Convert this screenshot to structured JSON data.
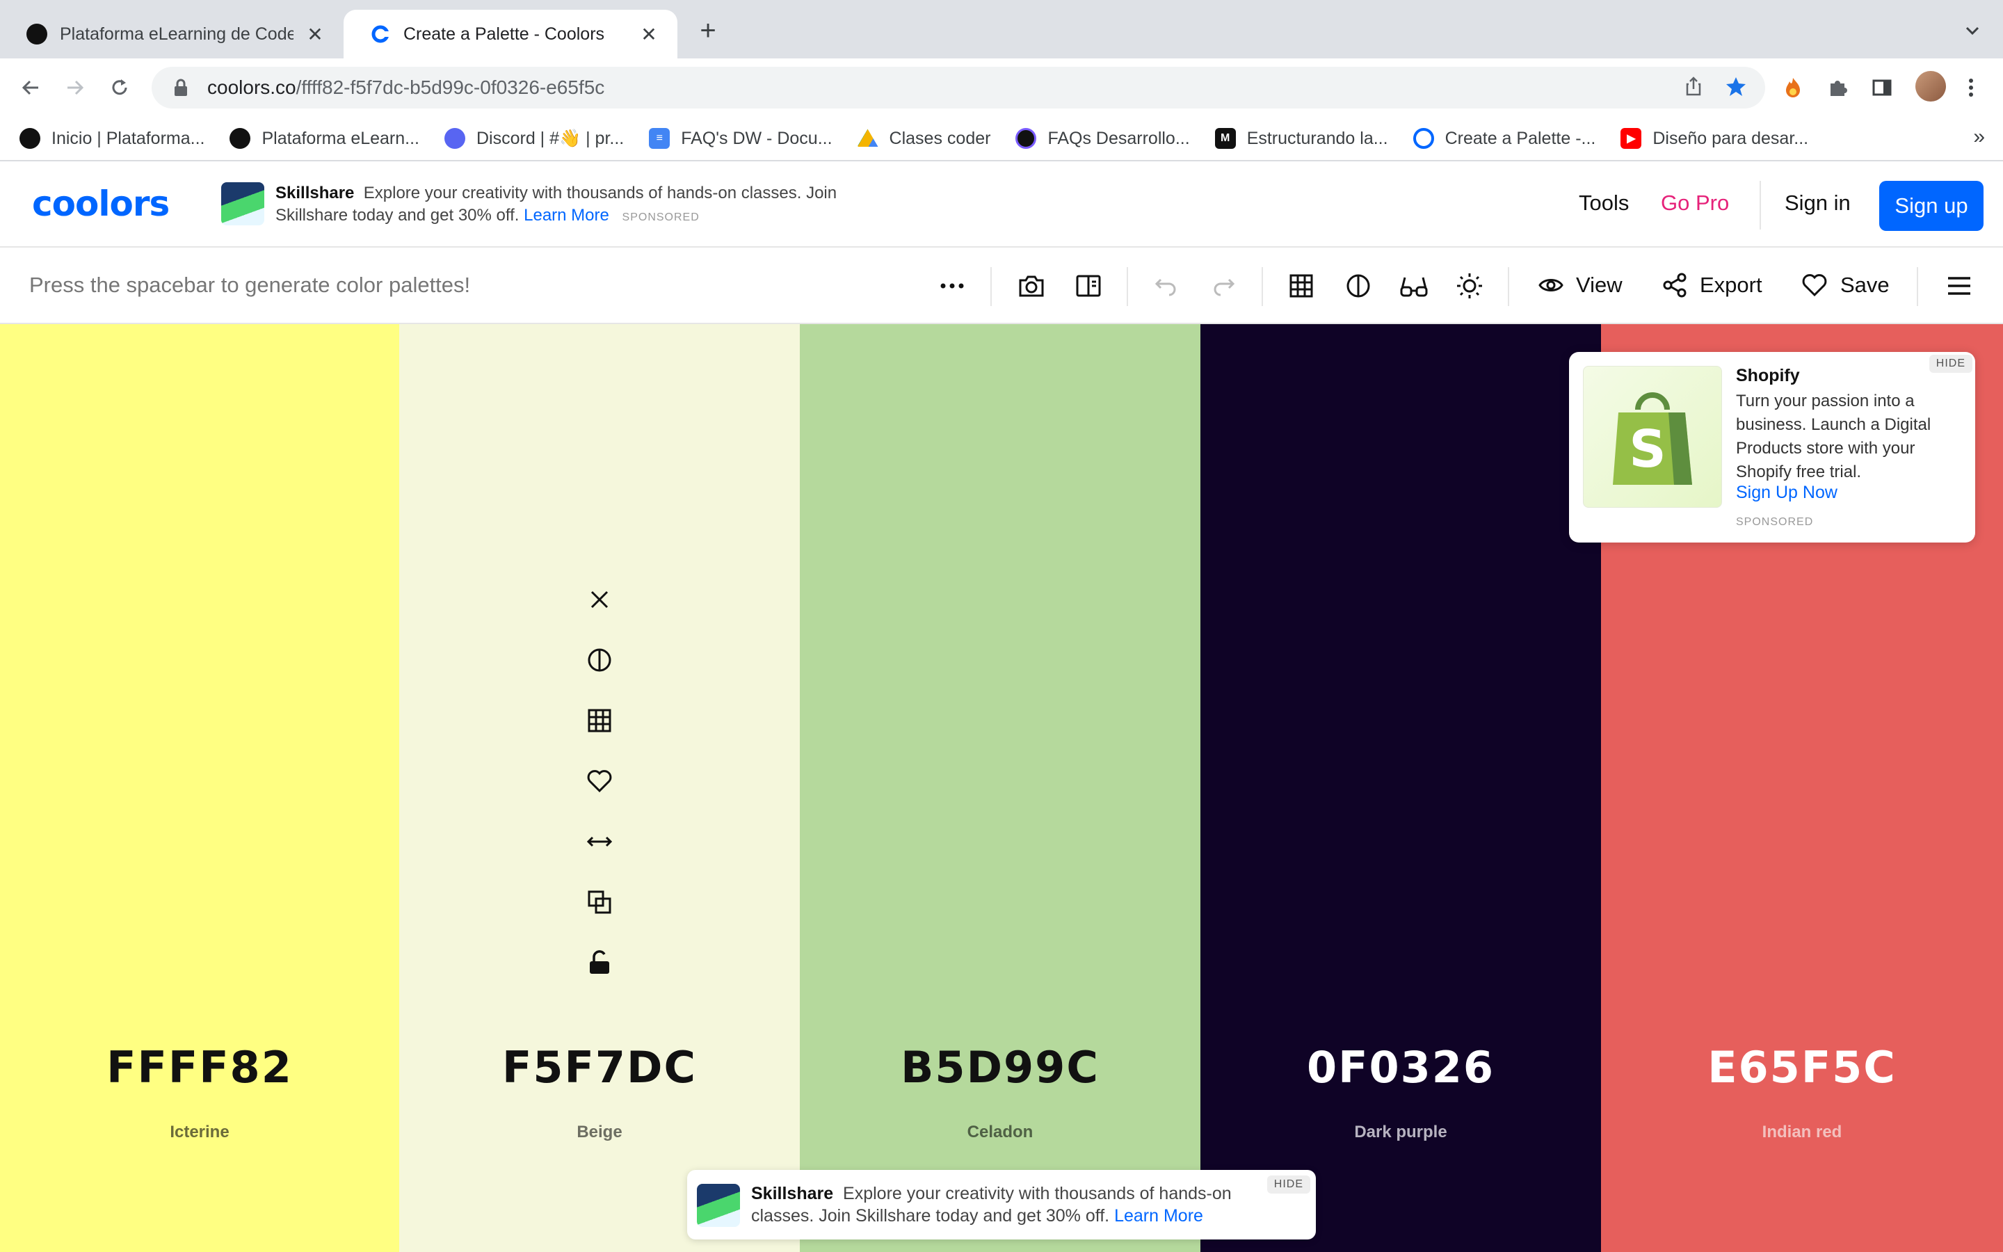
{
  "browser": {
    "tabs": [
      {
        "title": "Plataforma eLearning de Coder",
        "active": false
      },
      {
        "title": "Create a Palette - Coolors",
        "active": true
      }
    ],
    "url_host": "coolors.co",
    "url_path": "/ffff82-f5f7dc-b5d99c-0f0326-e65f5c",
    "bookmarks": [
      {
        "label": "Inicio | Plataforma...",
        "icon": "coder-icon"
      },
      {
        "label": "Plataforma eLearn...",
        "icon": "coder-icon"
      },
      {
        "label": "Discord | #👋 | pr...",
        "icon": "discord-icon"
      },
      {
        "label": "FAQ's DW - Docu...",
        "icon": "docs-icon"
      },
      {
        "label": "Clases coder",
        "icon": "drive-icon"
      },
      {
        "label": "FAQs Desarrollo...",
        "icon": "coder-icon"
      },
      {
        "label": "Estructurando la...",
        "icon": "medium-icon"
      },
      {
        "label": "Create a Palette -...",
        "icon": "coolors-icon"
      },
      {
        "label": "Diseño para desar...",
        "icon": "youtube-icon"
      }
    ],
    "bookmarks_more": "»"
  },
  "header": {
    "logo": "coolors",
    "ad": {
      "brand": "Skillshare",
      "text": "Explore your creativity with thousands of hands-on classes. Join Skillshare today and get 30% off.",
      "link": "Learn More",
      "sponsored": "SPONSORED"
    },
    "nav": {
      "tools": "Tools",
      "gopro": "Go Pro",
      "signin": "Sign in",
      "signup": "Sign up"
    }
  },
  "generator": {
    "hint": "Press the spacebar to generate color palettes!",
    "view_label": "View",
    "export_label": "Export",
    "save_label": "Save"
  },
  "palette": {
    "colors": [
      {
        "hex": "FFFF82",
        "name": "Icterine",
        "bg": "#ffff82",
        "text": "#111111",
        "sub": "#6b6b3a"
      },
      {
        "hex": "F5F7DC",
        "name": "Beige",
        "bg": "#f5f7dc",
        "text": "#111111",
        "sub": "#6d6e62"
      },
      {
        "hex": "B5D99C",
        "name": "Celadon",
        "bg": "#b5d99c",
        "text": "#111111",
        "sub": "#4f6145"
      },
      {
        "hex": "0F0326",
        "name": "Dark purple",
        "bg": "#0f0326",
        "text": "#ffffff",
        "sub": "#b7b3c0"
      },
      {
        "hex": "E65F5C",
        "name": "Indian red",
        "bg": "#e65f5c",
        "text": "#ffffff",
        "sub": "#f3c0be"
      }
    ]
  },
  "shopify_ad": {
    "title": "Shopify",
    "body": "Turn your passion into a business. Launch a Digital Products store with your Shopify free trial.",
    "cta": "Sign Up Now",
    "sponsored": "SPONSORED",
    "hide": "HIDE"
  },
  "bottom_ad": {
    "brand": "Skillshare",
    "text": "Explore your creativity with thousands of hands-on classes. Join Skillshare today and get 30% off.",
    "link": "Learn More",
    "hide": "HIDE"
  }
}
